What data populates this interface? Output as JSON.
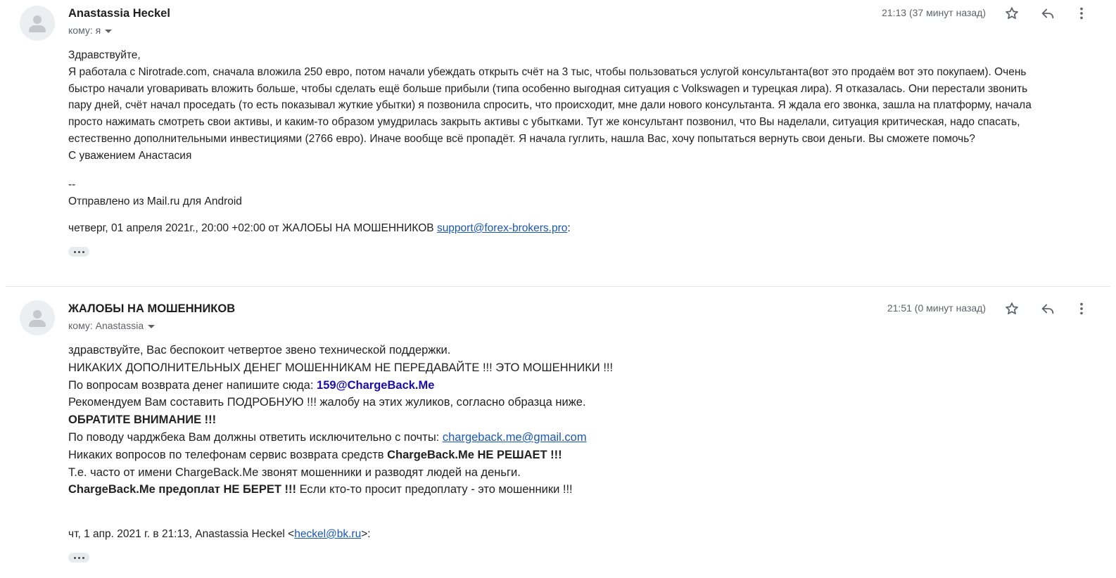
{
  "thread": [
    {
      "sender": "Anastassia Heckel",
      "to_label": "кому: я",
      "time": "21:13 (37 минут назад)",
      "body": [
        "Здравствуйте,",
        "Я работала с Nirotrade.com,  сначала вложила 250 евро, потом начали убеждать открыть счёт на 3 тыс, чтобы пользоваться услугой консультанта(вот это продаём  вот это покупаем). Очень",
        "быстро начали уговаривать вложить больше, чтобы сделать ещё больше прибыли (типа особенно выгодная ситуация с Volkswagen и турецкая лира). Я отказалась.  Они перестали звонить",
        "пару дней, счёт начал проседать (то есть показывал жуткие убытки) я позвонила спросить, что происходит,  мне дали нового консультанта. Я ждала его звонка,  зашла на платформу,  начала",
        "просто нажимать смотреть свои активы, и каким-то образом умудрилась закрыть активы с убытками. Тут же консультант позвонил,  что Вы наделали, ситуация критическая, надо спасать,",
        "естественно дополнительными инвестициями (2766 евро). Иначе вообще всё пропадёт. Я начала гуглить, нашла Вас, хочу попытаться вернуть свои деньги. Вы сможете помочь?",
        "С уважением Анастасия"
      ],
      "sig_sep": "--",
      "sig_text": "Отправлено из Mail.ru для Android",
      "quote_prefix": "четверг, 01 апреля 2021г., 20:00 +02:00 от ЖАЛОБЫ НА МОШЕННИКОВ ",
      "quote_email": "support@forex-brokers.pro",
      "quote_suffix": ":"
    },
    {
      "sender": "ЖАЛОБЫ НА МОШЕННИКОВ",
      "to_label": "кому: Anastassia",
      "time": "21:51 (0 минут назад)",
      "lines": {
        "l1": "здравствуйте, Вас беспокоит четвертое звено технической поддержки.",
        "l2": "НИКАКИХ ДОПОЛНИТЕЛЬНЫХ ДЕНЕГ МОШЕННИКАМ НЕ ПЕРЕДАВАЙТЕ !!! ЭТО МОШЕННИКИ !!!",
        "l3_text": "По вопросам возврата денег напишите сюда: ",
        "l3_email": "159@ChargeBack.Me",
        "l4": "Рекомендуем Вам составить ПОДРОБНУЮ !!! жалобу на этих жуликов, согласно образца ниже.",
        "l5": "ОБРАТИТЕ ВНИМАНИЕ !!!",
        "l6_text": "По поводу чарджбека Вам должны ответить исключительно с почты: ",
        "l6_email": "chargeback.me@gmail.com",
        "l7_text": "Никаких вопросов по телефонам сервис возврата средств ",
        "l7_bold": "ChargeBack.Me НЕ РЕШАЕТ !!!",
        "l8": "Т.е. часто от имени ChargeBack.Me звонят мошенники и разводят людей на деньги.",
        "l9_bold": "ChargeBack.Me предоплат НЕ БЕРЕТ !!!",
        "l9_text": " Если кто-то просит предоплату - это мошенники !!!"
      },
      "quote_prefix": "чт, 1 апр. 2021 г. в 21:13, Anastassia Heckel <",
      "quote_email": "heckel@bk.ru",
      "quote_suffix": ">:"
    }
  ],
  "icons": {
    "avatar": "person-icon",
    "star": "star-outline-icon",
    "reply": "reply-arrow-icon",
    "more": "more-vertical-icon",
    "expand": "ellipsis-icon"
  },
  "colors": {
    "link": "#1a57b5",
    "highlight_email": "#1a0dab",
    "muted": "#5f6368"
  }
}
